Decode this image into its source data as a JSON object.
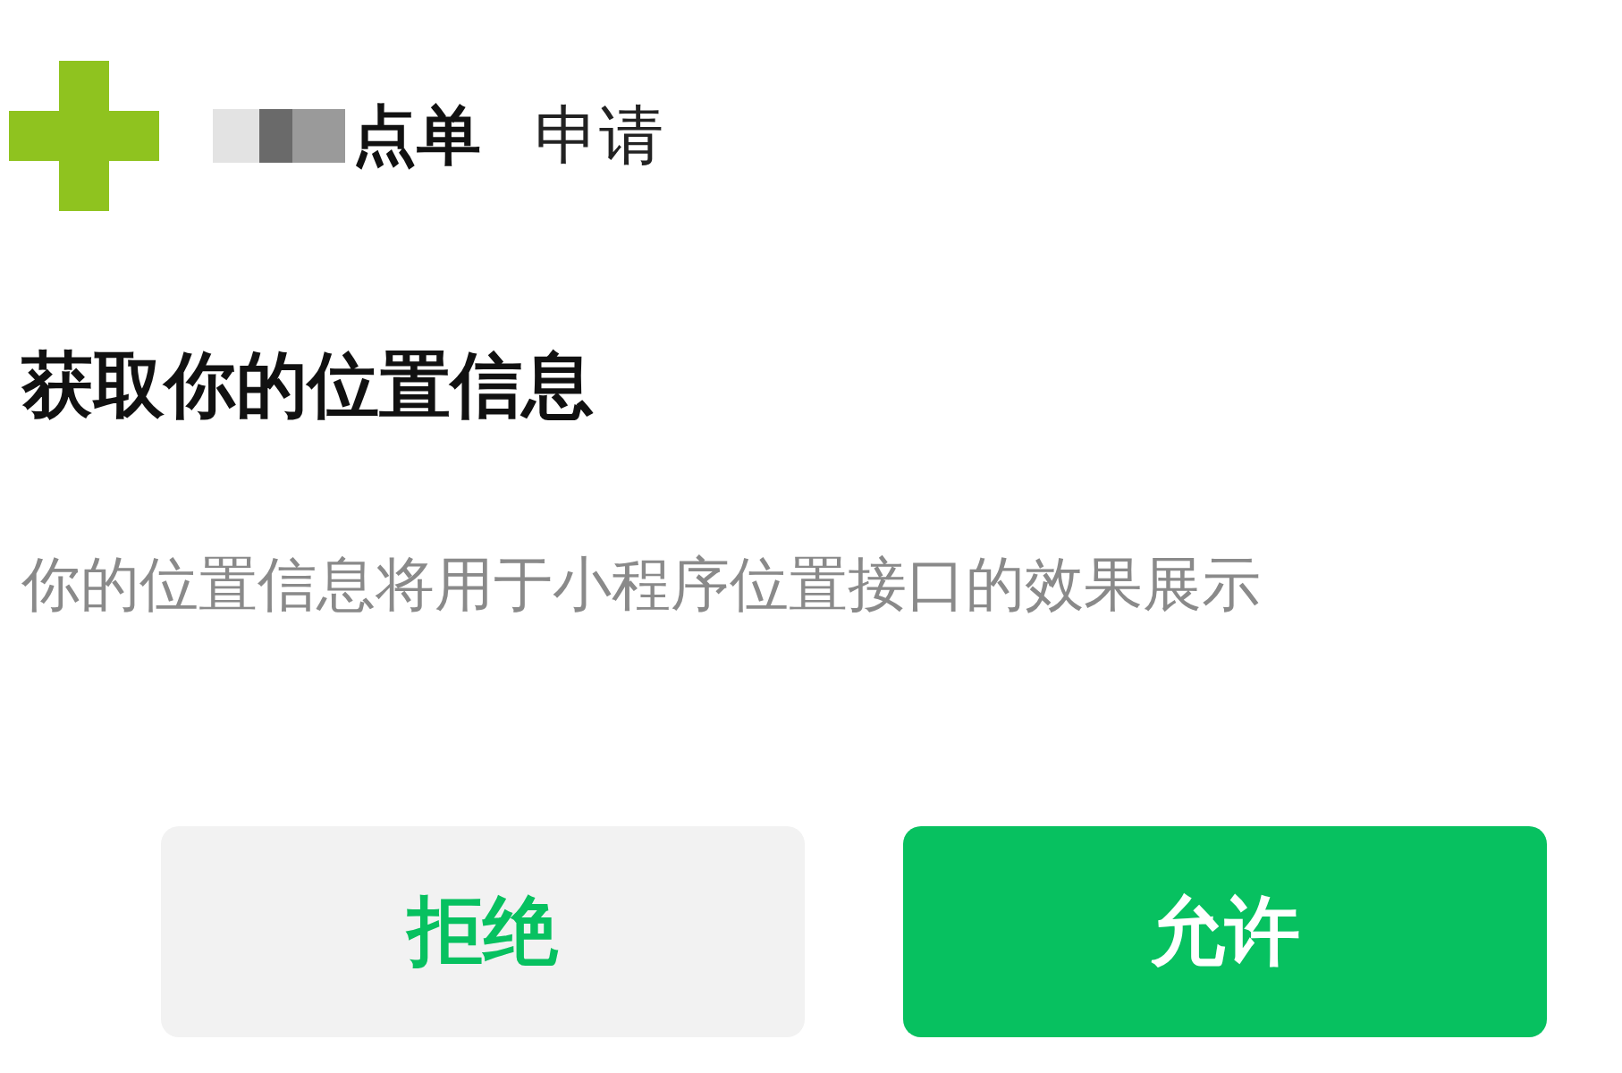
{
  "header": {
    "app_name": "点单",
    "action": "申请"
  },
  "title": "获取你的位置信息",
  "description": "你的位置信息将用于小程序位置接口的效果展示",
  "buttons": [
    {
      "label": "拒绝",
      "kind": "secondary"
    },
    {
      "label": "允许",
      "kind": "primary"
    }
  ]
}
